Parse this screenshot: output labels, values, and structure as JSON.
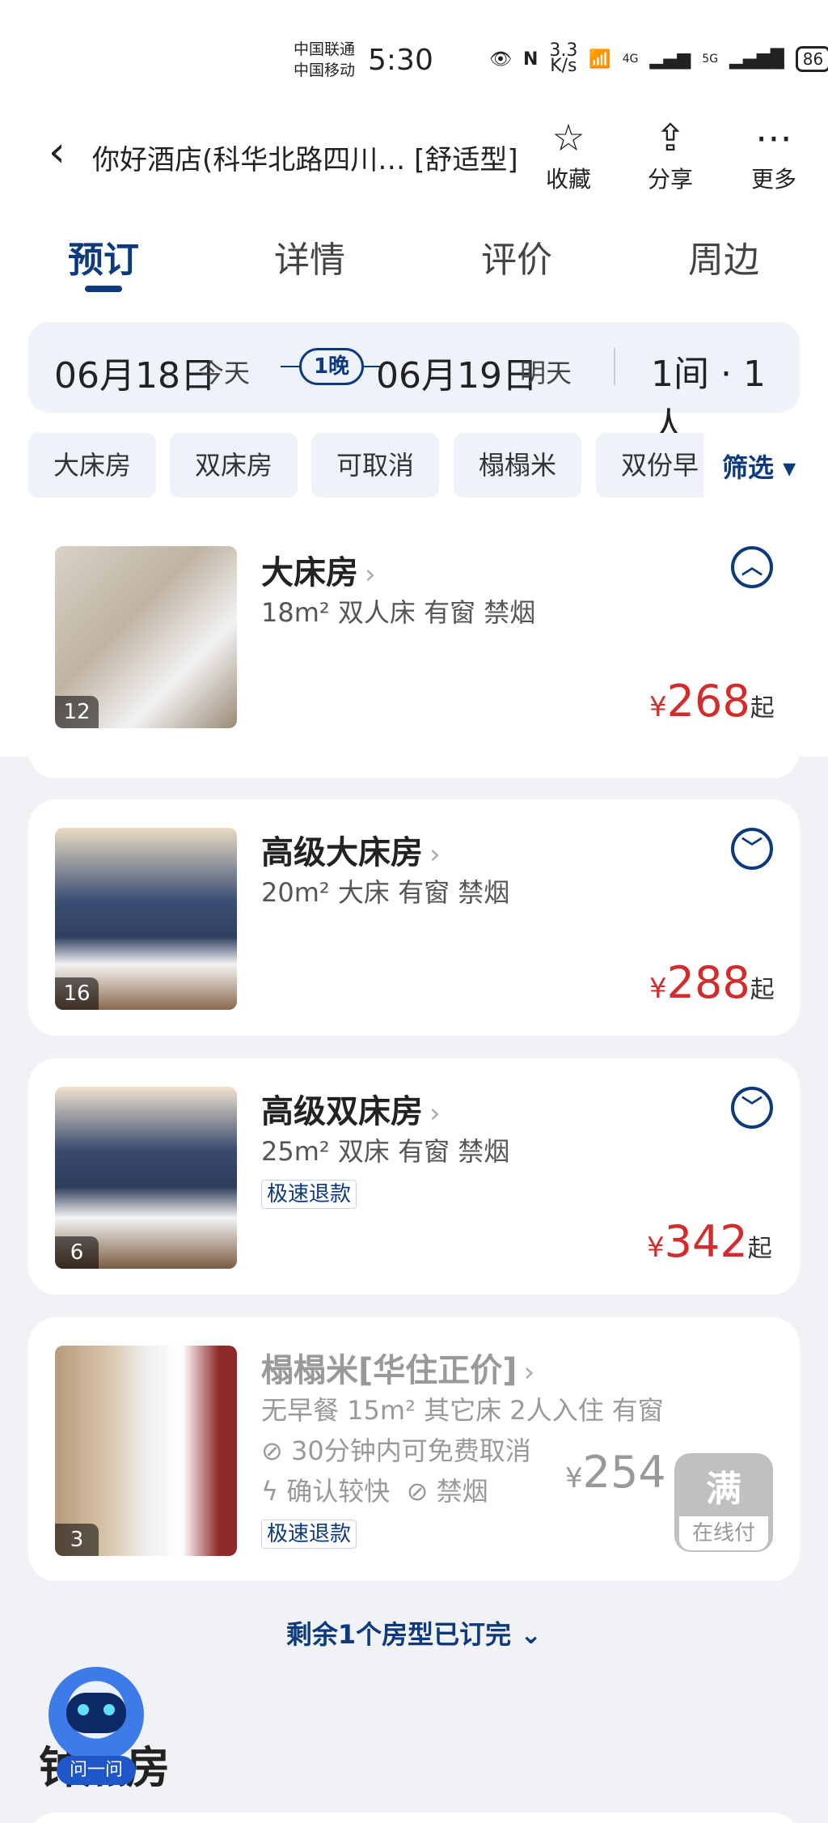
{
  "status_bar": {
    "carrier1": "中国联通",
    "carrier2": "中国移动",
    "time": "5:30",
    "speed_value": "3.3",
    "speed_unit": "K/s",
    "signal1": "4G",
    "signal2": "5G",
    "battery": "86"
  },
  "header": {
    "title": "你好酒店(科华北路四川… [舒适型]",
    "favorite_label": "收藏",
    "share_label": "分享",
    "more_label": "更多"
  },
  "tabs": [
    {
      "label": "预订",
      "active": true
    },
    {
      "label": "详情",
      "active": false
    },
    {
      "label": "评价",
      "active": false
    },
    {
      "label": "周边",
      "active": false
    }
  ],
  "date_bar": {
    "checkin_date": "06月18日",
    "checkin_sub": "今天",
    "nights": "1晚",
    "checkout_date": "06月19日",
    "checkout_sub": "明天",
    "guests": "1间 · 1人"
  },
  "filters": {
    "chips": [
      "大床房",
      "双床房",
      "可取消",
      "榻榻米",
      "双份早"
    ],
    "filter_label": "筛选 ▾"
  },
  "rooms": [
    {
      "name": "大床房",
      "desc": "18m² 双人床 有窗 禁烟",
      "photo_count": "12",
      "price_symbol": "¥",
      "price": "268",
      "price_suffix": "起",
      "expanded": true
    },
    {
      "name": "高级大床房",
      "desc": "20m² 大床 有窗 禁烟",
      "photo_count": "16",
      "price_symbol": "¥",
      "price": "288",
      "price_suffix": "起",
      "expanded": false
    },
    {
      "name": "高级双床房",
      "desc": "25m² 双床 有窗 禁烟",
      "photo_count": "6",
      "badge": "极速退款",
      "price_symbol": "¥",
      "price": "342",
      "price_suffix": "起",
      "expanded": false
    },
    {
      "name": "榻榻米[华住正价]",
      "desc": "无早餐 15m² 其它床 2人入住 有窗",
      "cancel": "30分钟内可免费取消",
      "confirm": "确认较快",
      "smoke": "禁烟",
      "photo_count": "3",
      "badge": "极速退款",
      "price_symbol": "¥",
      "price": "254",
      "full_label": "满",
      "pay_label": "在线付"
    }
  ],
  "soldout_text": "剩余1个房型已订完 ⌄",
  "assistant": {
    "label": "问一问"
  },
  "bottom_section_title": "钟点房"
}
